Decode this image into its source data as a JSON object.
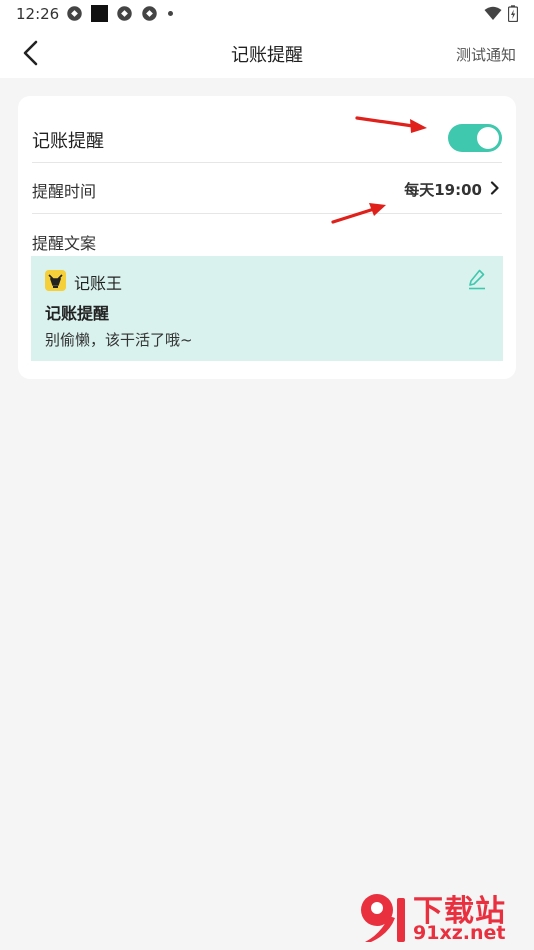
{
  "status_bar": {
    "time": "12:26"
  },
  "header": {
    "title": "记账提醒",
    "action_label": "测试通知"
  },
  "settings": {
    "remind_label": "记账提醒",
    "remind_enabled": true,
    "time_label": "提醒时间",
    "time_value": "每天19:00",
    "copy_label": "提醒文案"
  },
  "notification": {
    "app_name": "记账王",
    "title": "记账提醒",
    "body": "别偷懒，该干活了哦~"
  },
  "colors": {
    "accent": "#3fc8ad",
    "preview_bg": "#d9f2ee",
    "annotation_arrow": "#e0201a"
  },
  "watermark": {
    "line1": "下载站",
    "line2": "91xz.net"
  }
}
